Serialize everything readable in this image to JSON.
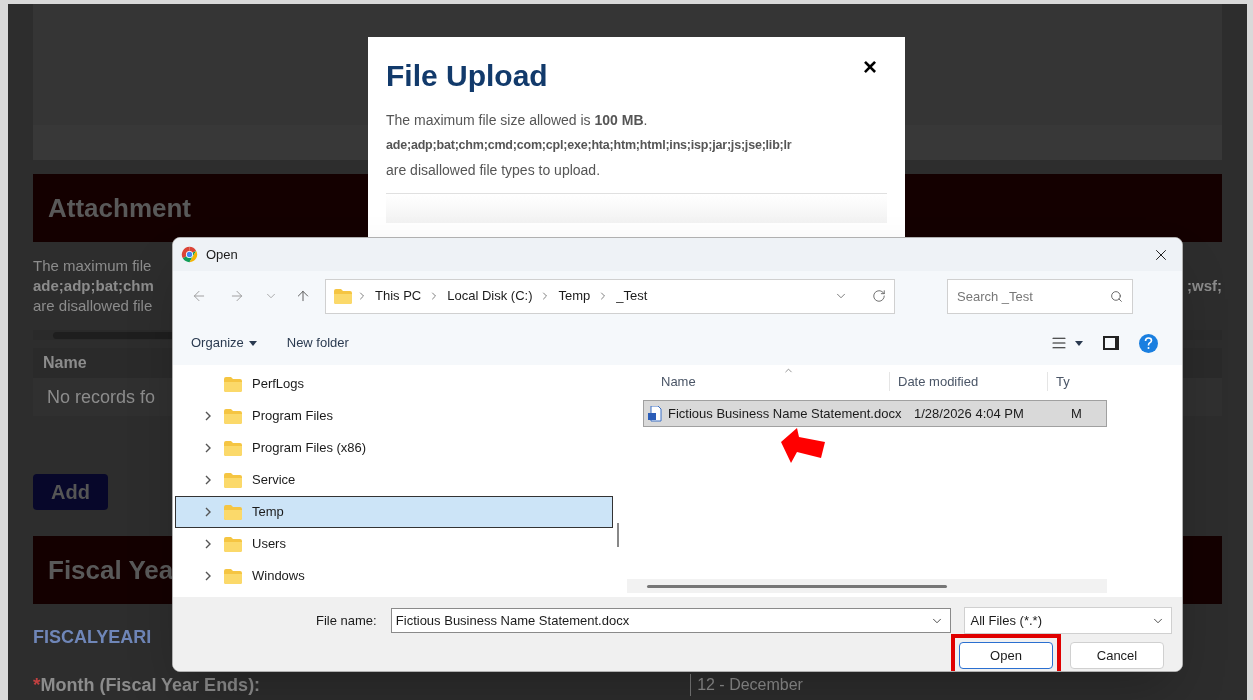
{
  "background_page": {
    "attachment_heading": "Attachment",
    "notice_lines": [
      "The maximum file",
      "ade;adp;bat;chm",
      "are disallowed file"
    ],
    "notice_tail": ";wsf;",
    "table": {
      "columns": [
        "Name"
      ],
      "empty_text": "No records fo"
    },
    "add_button": "Add",
    "fiscal_heading": "Fiscal Yea",
    "fiscal_subheading": "FISCALYEARI",
    "month_field": {
      "required_mark": "*",
      "label": "Month (Fiscal Year Ends):",
      "value": "12 - December"
    }
  },
  "upload_modal": {
    "title": "File Upload",
    "close": "×",
    "size_notice": "The maximum file size allowed is **100 MB**.",
    "file_types": "ade;adp;bat;chm;cmd;com;cpl;exe;hta;htm;html;ins;isp;jar;js;jse;lib;lr",
    "disallowed_note": "are disallowed file types to upload."
  },
  "open_dialog": {
    "title": "Open",
    "breadcrumb": [
      "This PC",
      "Local Disk (C:)",
      "Temp",
      "_Test"
    ],
    "search_placeholder": "Search _Test",
    "toolbar": [
      {
        "label": "Organize",
        "dropdown": true
      },
      {
        "label": "New folder",
        "dropdown": false
      }
    ],
    "nav_items": [
      {
        "label": "PerfLogs",
        "expandable": false,
        "selected": false
      },
      {
        "label": "Program Files",
        "expandable": true,
        "selected": false
      },
      {
        "label": "Program Files (x86)",
        "expandable": true,
        "selected": false
      },
      {
        "label": "Service",
        "expandable": true,
        "selected": false
      },
      {
        "label": "Temp",
        "expandable": true,
        "selected": true
      },
      {
        "label": "Users",
        "expandable": true,
        "selected": false
      },
      {
        "label": "Windows",
        "expandable": true,
        "selected": false
      }
    ],
    "columns": [
      "Name",
      "Date modified",
      "Ty"
    ],
    "files": [
      {
        "name": "Fictious Business Name Statement.docx",
        "date": "1/28/2026 4:04 PM",
        "type": "M",
        "selected": true
      }
    ],
    "file_name_label": "File name:",
    "file_name_value": "Fictious Business Name Statement.docx",
    "filter": "All Files (*.*)",
    "buttons": [
      {
        "label": "Open",
        "kind": "primary",
        "highlighted": true
      },
      {
        "label": "Cancel",
        "kind": "secondary",
        "highlighted": false
      }
    ]
  }
}
